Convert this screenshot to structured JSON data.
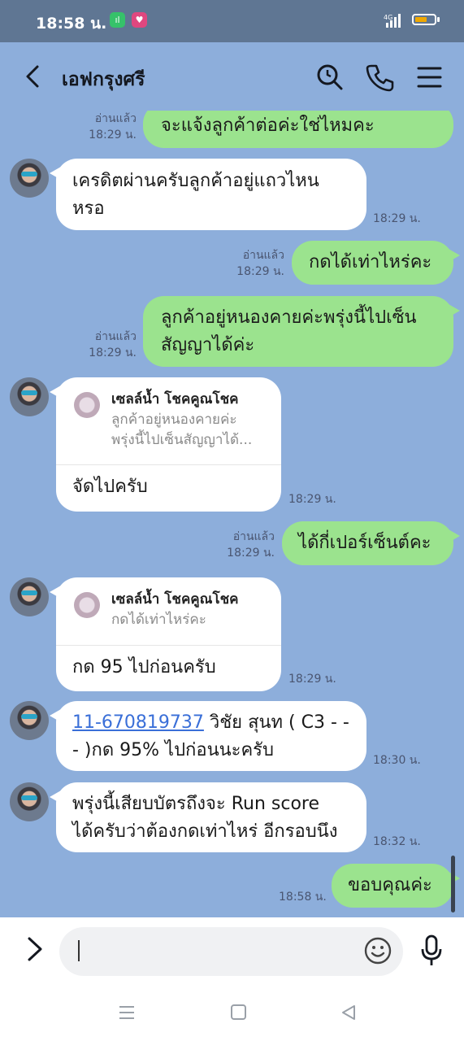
{
  "status_bar": {
    "time": "18:58 น.",
    "network": "4G",
    "battery_level": 0.65
  },
  "header": {
    "back_icon": "chevron-left-icon",
    "title": "เอฟกรุงศรี",
    "icons": [
      "search-icon",
      "phone-icon",
      "menu-icon"
    ]
  },
  "messages": [
    {
      "side": "me",
      "read": "อ่านแล้ว",
      "time": "18:29 น.",
      "text": "จะแจ้งลูกค้าต่อค่ะใช่ไหมคะ"
    },
    {
      "side": "them",
      "time": "18:29 น.",
      "lines": [
        "เครดิตผ่านครับลูกค้าอยู่แถวไหน",
        "หรอ"
      ]
    },
    {
      "side": "me",
      "read": "อ่านแล้ว",
      "time": "18:29 น.",
      "text": "กดได้เท่าไหร่คะ"
    },
    {
      "side": "me",
      "read": "อ่านแล้ว",
      "time": "18:29 น.",
      "lines": [
        "ลูกค้าอยู่หนองคายค่ะพรุ่งนี้ไปเซ็น",
        "สัญญาได้ค่ะ"
      ]
    },
    {
      "side": "them",
      "time": "18:29 น.",
      "reply_name": "เซลล์น้ำ โชคคูณโชค",
      "reply_lines": [
        "ลูกค้าอยู่หนองคายค่ะ",
        "พรุ่งนี้ไปเซ็นสัญญาได้..."
      ],
      "text": "จัดไปครับ"
    },
    {
      "side": "me",
      "read": "อ่านแล้ว",
      "time": "18:29 น.",
      "text": "ได้กี่เปอร์เซ็นต์คะ"
    },
    {
      "side": "them",
      "time": "18:29 น.",
      "reply_name": "เซลล์น้ำ โชคคูณโชค",
      "reply_lines": [
        "กดได้เท่าไหร่คะ"
      ],
      "text": "กด 95 ไปก่อนครับ"
    },
    {
      "side": "them",
      "time": "18:30 น.",
      "link": "11-670819737",
      "line1_rest": " วิชัย สุนท ( C3 - -",
      "line2": "- )กด 95% ไปก่อนนะครับ"
    },
    {
      "side": "them",
      "time": "18:32 น.",
      "lines": [
        "พรุ่งนี้เสียบบัตรถึงจะ Run score",
        "ได้ครับว่าต้องกดเท่าไหร่ อีกรอบนึง"
      ]
    },
    {
      "side": "me",
      "time": "18:58 น.",
      "text": "ขอบคุณค่ะ"
    }
  ],
  "input_bar": {
    "placeholder": "",
    "icons": [
      "expand-icon",
      "emoji-icon",
      "microphone-icon"
    ]
  },
  "nav_bar": {
    "icons": [
      "recent-apps-icon",
      "home-icon",
      "back-nav-icon"
    ]
  },
  "colors": {
    "chat_bg": "#8daedb",
    "my_bubble": "#9be38e",
    "their_bubble": "#ffffff",
    "status_bar": "#5f7693",
    "link": "#3a6fd8"
  }
}
